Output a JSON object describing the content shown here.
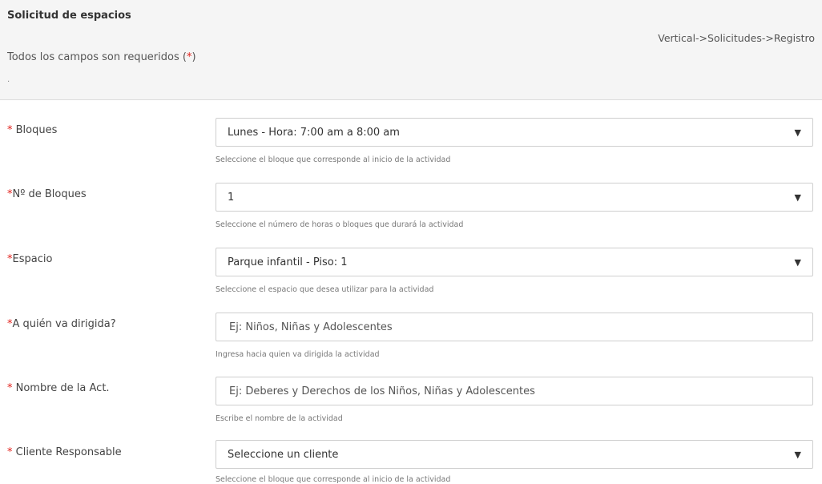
{
  "header": {
    "title": "Solicitud de espacios",
    "breadcrumb": "Vertical->Solicitudes->Registro",
    "required_note_prefix": "Todos los campos son requeridos (",
    "required_note_star": "*",
    "required_note_suffix": ")",
    "dot": "."
  },
  "fields": {
    "bloques": {
      "required_mark": "*",
      "label": " Bloques",
      "value": "Lunes - Hora: 7:00 am a 8:00 am",
      "help": "Seleccione el bloque que corresponde al inicio de la actividad"
    },
    "n_bloques": {
      "required_mark": "*",
      "label": "Nº de Bloques",
      "value": "1",
      "help": "Seleccione el número de horas o bloques que durará la actividad"
    },
    "espacio": {
      "required_mark": "*",
      "label": "Espacio",
      "value": "Parque infantil - Piso: 1",
      "help": "Seleccione el espacio que desea utilizar para la actividad"
    },
    "dirigida": {
      "required_mark": "*",
      "label": "A quién va dirigida?",
      "placeholder": "Ej: Niños, Niñas y Adolescentes",
      "help": "Ingresa hacia quien va dirigida la actividad"
    },
    "nombre": {
      "required_mark": "*",
      "label": " Nombre de la Act.",
      "placeholder": "Ej: Deberes y Derechos de los Niños, Niñas y Adolescentes",
      "help": "Escribe el nombre de la actividad"
    },
    "cliente": {
      "required_mark": "*",
      "label": " Cliente Responsable",
      "value": "Seleccione un cliente",
      "help": "Seleccione el bloque que corresponde al inicio de la actividad"
    }
  },
  "colors": {
    "required": "#e2201b",
    "header_bg": "#f5f5f5",
    "border": "#cfcfcf"
  },
  "icons": {
    "select_caret": "caret-down-icon"
  }
}
